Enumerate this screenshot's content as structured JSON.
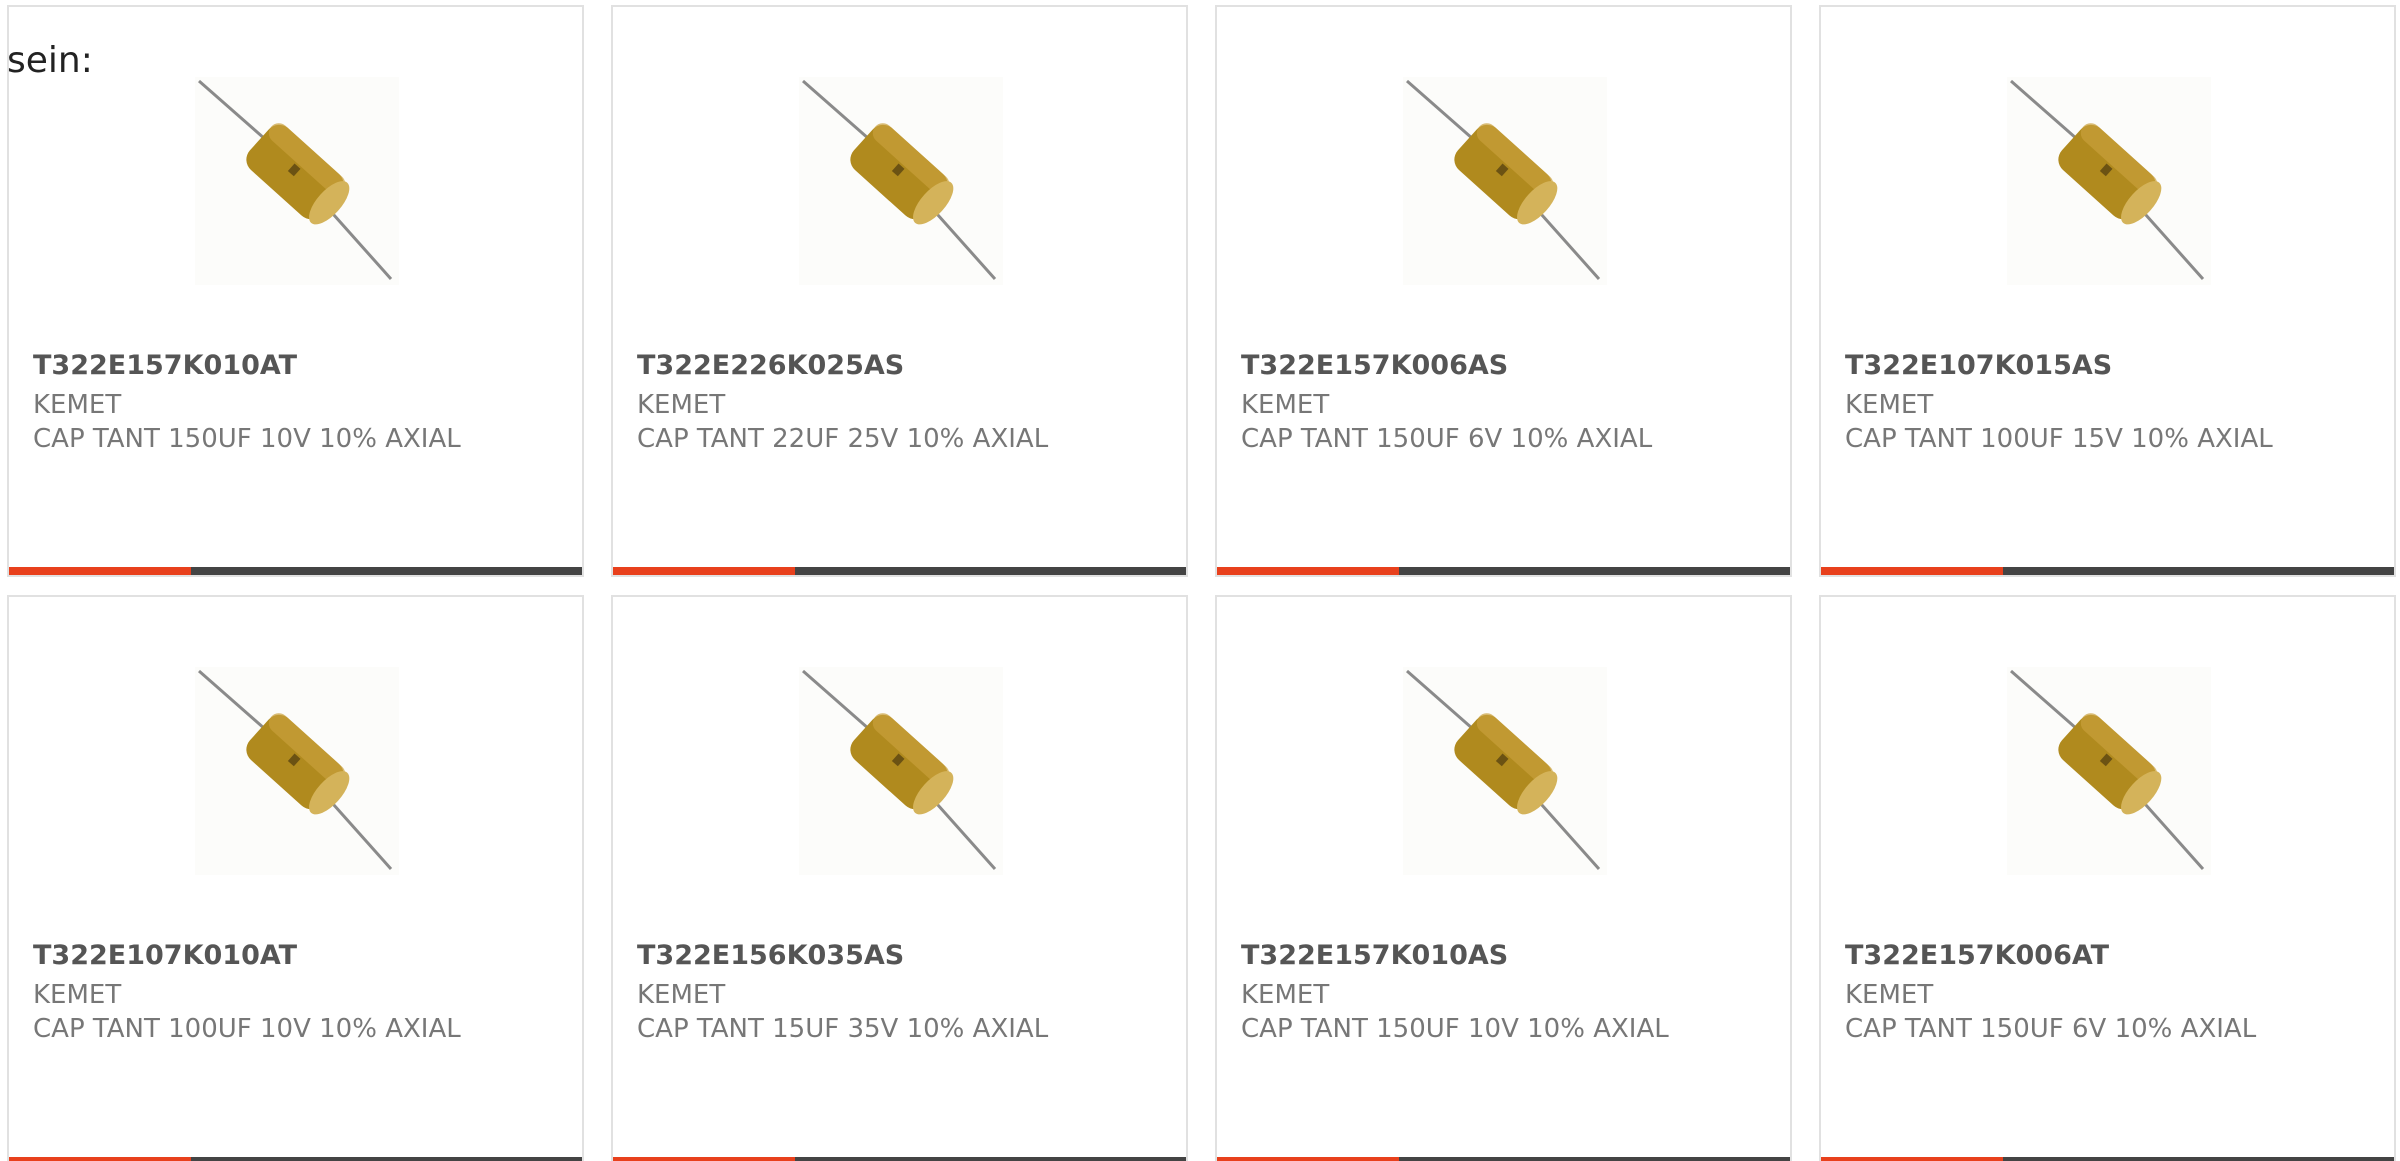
{
  "page": {
    "intro_text": "sein:"
  },
  "colors": {
    "accent": "#e8401c",
    "bar": "#444444",
    "card_border": "#e1e1e1"
  },
  "products": [
    {
      "part_number": "T322E157K010AT",
      "manufacturer": "KEMET",
      "description": "CAP TANT 150UF 10V 10% AXIAL",
      "image_icon": "axial-tantalum-capacitor-icon"
    },
    {
      "part_number": "T322E226K025AS",
      "manufacturer": "KEMET",
      "description": "CAP TANT 22UF 25V 10% AXIAL",
      "image_icon": "axial-tantalum-capacitor-icon"
    },
    {
      "part_number": "T322E157K006AS",
      "manufacturer": "KEMET",
      "description": "CAP TANT 150UF 6V 10% AXIAL",
      "image_icon": "axial-tantalum-capacitor-icon"
    },
    {
      "part_number": "T322E107K015AS",
      "manufacturer": "KEMET",
      "description": "CAP TANT 100UF 15V 10% AXIAL",
      "image_icon": "axial-tantalum-capacitor-icon"
    },
    {
      "part_number": "T322E107K010AT",
      "manufacturer": "KEMET",
      "description": "CAP TANT 100UF 10V 10% AXIAL",
      "image_icon": "axial-tantalum-capacitor-icon"
    },
    {
      "part_number": "T322E156K035AS",
      "manufacturer": "KEMET",
      "description": "CAP TANT 15UF 35V 10% AXIAL",
      "image_icon": "axial-tantalum-capacitor-icon"
    },
    {
      "part_number": "T322E157K010AS",
      "manufacturer": "KEMET",
      "description": "CAP TANT 150UF 10V 10% AXIAL",
      "image_icon": "axial-tantalum-capacitor-icon"
    },
    {
      "part_number": "T322E157K006AT",
      "manufacturer": "KEMET",
      "description": "CAP TANT 150UF 6V 10% AXIAL",
      "image_icon": "axial-tantalum-capacitor-icon"
    }
  ]
}
